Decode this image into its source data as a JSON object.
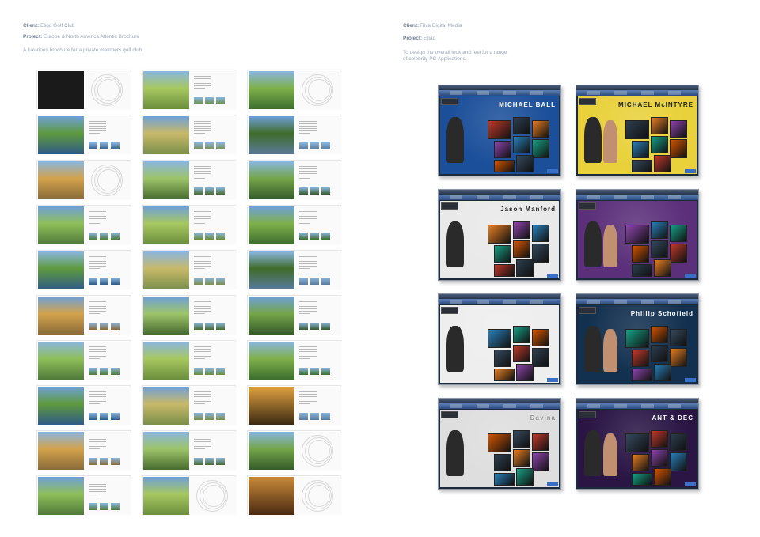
{
  "left": {
    "client_label": "Client:",
    "client_value": "Eligo Golf Club",
    "project_label": "Project:",
    "project_value": "Europe & North America Atlantic Brochure",
    "description": "A luxurious brochure for a private members golf club."
  },
  "right": {
    "client_label": "Client:",
    "client_value": "Riva Digital Media",
    "project_label": "Project:",
    "project_value": "Epac",
    "description_line1": "To design the overall look and feel for a range",
    "description_line2": "of celebrity PC Applications."
  },
  "screens": [
    {
      "name": "MICHAEL BALL",
      "bg": "#1b4f9a"
    },
    {
      "name": "MICHAEL McINTYRE",
      "bg": "#e8d13a"
    },
    {
      "name": "Jason Manford",
      "bg": "#e9e9e9"
    },
    {
      "name": "",
      "bg": "#5b2f7a"
    },
    {
      "name": "",
      "bg": "#eeeeee"
    },
    {
      "name": "Phillip Schofield",
      "bg": "#12304f"
    },
    {
      "name": "Davina",
      "bg": "#dedede"
    },
    {
      "name": "ANT & DEC",
      "bg": "#2a1545"
    }
  ],
  "colors": {
    "meta_text": "#9aa7b8",
    "meta_label": "#6f7f96"
  }
}
